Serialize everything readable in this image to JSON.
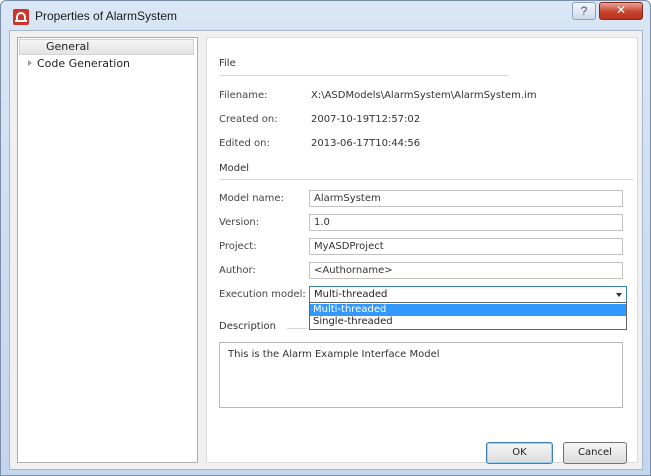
{
  "window": {
    "title": "Properties of AlarmSystem",
    "help_glyph": "?",
    "close_glyph": "✕"
  },
  "nav": {
    "items": [
      {
        "label": "General",
        "selected": true
      },
      {
        "label": "Code Generation",
        "expandable": true
      }
    ]
  },
  "file_section": {
    "title": "File",
    "filename_label": "Filename:",
    "filename_value": "X:\\ASDModels\\AlarmSystem\\AlarmSystem.im",
    "created_label": "Created on:",
    "created_value": "2007-10-19T12:57:02",
    "edited_label": "Edited on:",
    "edited_value": "2013-06-17T10:44:56"
  },
  "model_section": {
    "title": "Model",
    "model_name_label": "Model name:",
    "model_name_value": "AlarmSystem",
    "version_label": "Version:",
    "version_value": "1.0",
    "project_label": "Project:",
    "project_value": "MyASDProject",
    "author_label": "Author:",
    "author_value": "<Authorname>",
    "execution_label": "Execution model:",
    "execution_value": "Multi-threaded",
    "execution_options": [
      "Multi-threaded",
      "Single-threaded"
    ]
  },
  "description_section": {
    "title": "Description",
    "text": "This is the Alarm Example Interface Model"
  },
  "buttons": {
    "ok": "OK",
    "cancel": "Cancel"
  },
  "colors": {
    "accent": "#3399ff",
    "close": "#c8412c"
  }
}
